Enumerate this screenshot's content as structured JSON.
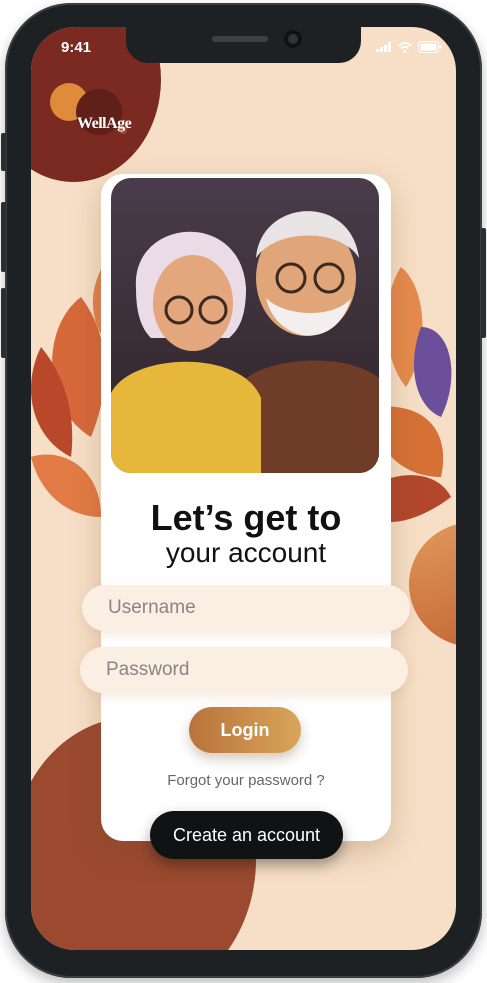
{
  "status_bar": {
    "time": "9:41"
  },
  "brand": {
    "logo_text": "WellAge"
  },
  "login": {
    "title_line1": "Let’s get to",
    "title_line2": "your account",
    "username_placeholder": "Username",
    "password_placeholder": "Password",
    "login_label": "Login",
    "forgot_label": "Forgot your password ?",
    "create_account_label": "Create an account"
  },
  "colors": {
    "background": "#f6dfc6",
    "accent": "#c98a47",
    "dark_button": "#0f1314",
    "brand_blob": "#8a2e1f"
  },
  "icons": [
    "signal-icon",
    "wifi-icon",
    "battery-icon"
  ]
}
